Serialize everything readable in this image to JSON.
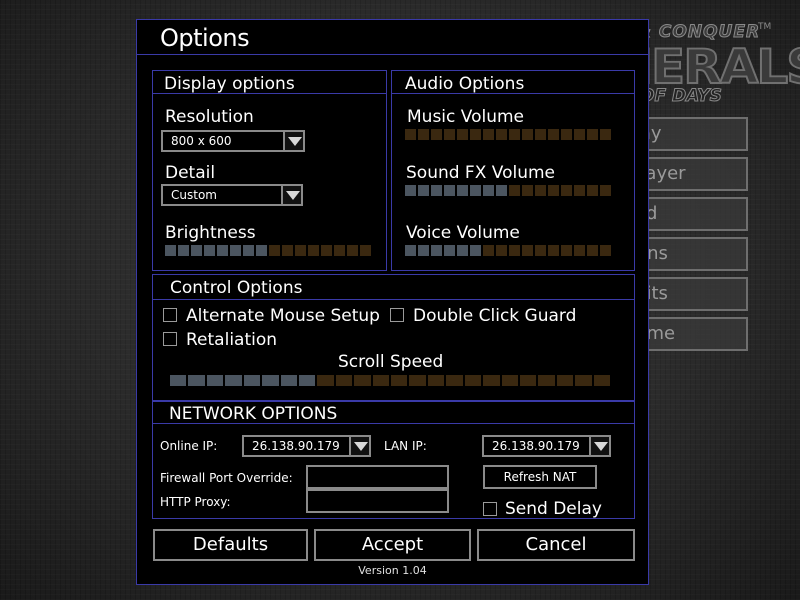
{
  "background": {
    "logo": {
      "top": "COMMAND & CONQUER",
      "trademark": "TM",
      "main": "GENERALS",
      "sub": "OF DAYS"
    },
    "menu": [
      {
        "label": "Play"
      },
      {
        "label": "iplayer"
      },
      {
        "label": "oad"
      },
      {
        "label": "tions"
      },
      {
        "label": "edits"
      },
      {
        "label": "game"
      }
    ]
  },
  "dialog": {
    "title": "Options",
    "display": {
      "title": "Display options",
      "resolution_label": "Resolution",
      "resolution_value": "800 x 600",
      "detail_label": "Detail",
      "detail_value": "Custom",
      "brightness_label": "Brightness",
      "brightness_level": 0.5
    },
    "audio": {
      "title": "Audio Options",
      "music_label": "Music Volume",
      "music_level": 0,
      "sfx_label": "Sound FX Volume",
      "sfx_level": 0.5,
      "voice_label": "Voice Volume",
      "voice_level": 0.35
    },
    "control": {
      "title": "Control Options",
      "alt_mouse_label": "Alternate Mouse Setup",
      "alt_mouse_checked": false,
      "double_click_label": "Double Click Guard",
      "double_click_checked": false,
      "retaliation_label": "Retaliation",
      "retaliation_checked": false,
      "scroll_label": "Scroll Speed",
      "scroll_level": 0.33
    },
    "network": {
      "title": "NETWORK OPTIONS",
      "online_ip_label": "Online IP:",
      "online_ip_value": "26.138.90.179",
      "lan_ip_label": "LAN IP:",
      "lan_ip_value": "26.138.90.179",
      "firewall_label": "Firewall Port Override:",
      "firewall_value": "",
      "proxy_label": "HTTP Proxy:",
      "proxy_value": "",
      "refresh_nat_label": "Refresh NAT",
      "send_delay_label": "Send Delay",
      "send_delay_checked": false
    },
    "buttons": {
      "defaults": "Defaults",
      "accept": "Accept",
      "cancel": "Cancel"
    },
    "version": "Version 1.04"
  },
  "colors": {
    "panel_border": "#3a3aa8",
    "slider_on": "#4b5560",
    "slider_off": "#3a2810",
    "control_border": "#8a8a8a"
  }
}
